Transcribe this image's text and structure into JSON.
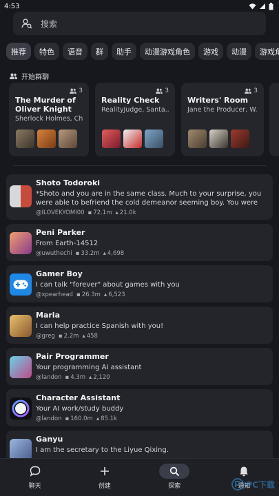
{
  "status": {
    "time": "4:53"
  },
  "search": {
    "placeholder": "搜索"
  },
  "categories": [
    "推荐",
    "特色",
    "语音",
    "群",
    "助手",
    "动漫游戏角色",
    "游戏",
    "动漫",
    "游戏角色"
  ],
  "group_section": {
    "title": "开始群聊"
  },
  "group_chats": [
    {
      "title": "The Murder of Oliver Knight",
      "subtitle": "Sherlock Holmes, Chi...",
      "count": "3"
    },
    {
      "title": "Reality Check",
      "subtitle": "RealityJudge, Santa...",
      "count": "3"
    },
    {
      "title": "Writers' Room",
      "subtitle": "Jane the Producer, W...",
      "count": "3"
    }
  ],
  "characters": [
    {
      "name": "Shoto Todoroki",
      "desc": "*Shoto and you are in the same class. Much to your surprise, you were able to befriend the cold demeanor seeming boy. You were currently walking home f...",
      "author": "@ILOVEKYOMI00",
      "chats": "72.1m",
      "likes": "21.0k"
    },
    {
      "name": "Peni Parker",
      "desc": "From Earth-14512",
      "author": "@uwuthechi",
      "chats": "33.2m",
      "likes": "4,698"
    },
    {
      "name": "Gamer Boy",
      "desc": "I can talk \"forever\" about games with you",
      "author": "@xpearhead",
      "chats": "26.3m",
      "likes": "6,523"
    },
    {
      "name": "Maria",
      "desc": "I can help practice Spanish with you!",
      "author": "@greg",
      "chats": "2.2m",
      "likes": "458"
    },
    {
      "name": "Pair Programmer",
      "desc": "Your programming AI assistant",
      "author": "@landon",
      "chats": "4.3m",
      "likes": "2,120"
    },
    {
      "name": "Character Assistant",
      "desc": "Your AI work/study buddy",
      "author": "@landon",
      "chats": "160.0m",
      "likes": "85.1k"
    },
    {
      "name": "Ganyu",
      "desc": "I am the secretary to the Liyue Qixing.",
      "author": "",
      "chats": "",
      "likes": ""
    }
  ],
  "nav": {
    "chat": "聊天",
    "create": "创建",
    "explore": "探索",
    "notify": "通知"
  },
  "watermark": {
    "text": "PC下载"
  },
  "colors": {
    "background": "#17181d",
    "card": "#23252b",
    "accent": "#3a3e48",
    "gamer_icon": "#1e88e5"
  }
}
